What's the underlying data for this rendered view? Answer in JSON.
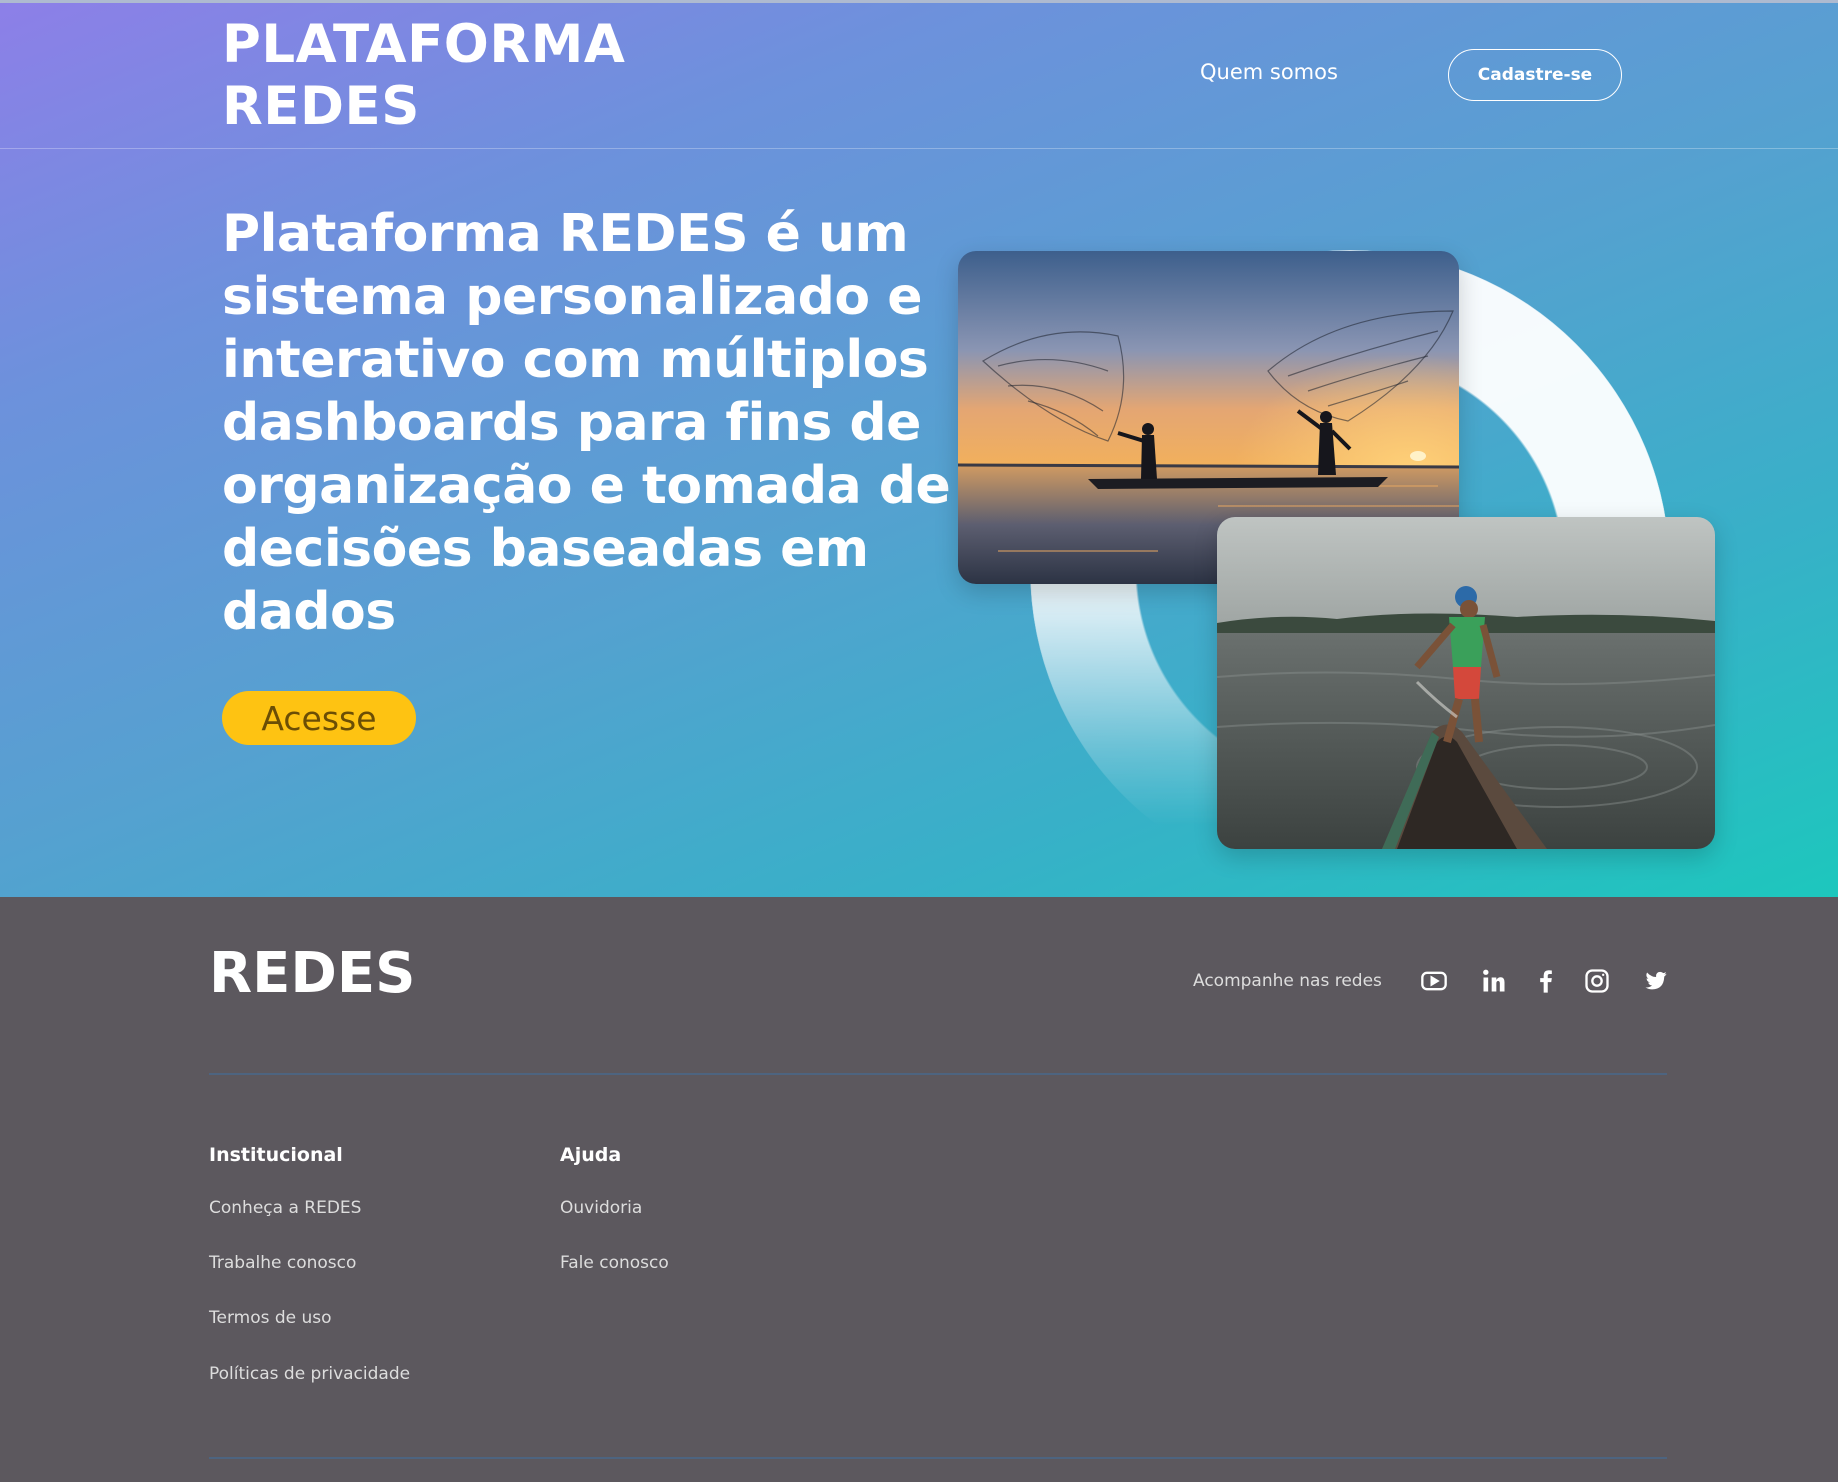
{
  "header": {
    "logo_line1": "PLATAFORMA",
    "logo_line2": "REDES",
    "nav_about": "Quem somos",
    "signup_label": "Cadastre-se"
  },
  "hero": {
    "headline": "Plataforma REDES é um sistema personalizado e interativo com múltiplos dashboards para fins de organização e tomada de decisões baseadas em dados",
    "cta_label": "Acesse",
    "accent_color": "#fec312"
  },
  "footer": {
    "logo": "REDES",
    "follow_label": "Acompanhe nas redes",
    "socials": [
      "youtube-icon",
      "linkedin-icon",
      "facebook-icon",
      "instagram-icon",
      "twitter-icon"
    ],
    "institucional": {
      "title": "Institucional",
      "links": [
        "Conheça a REDES",
        "Trabalhe conosco",
        "Termos de uso",
        "Políticas de privacidade"
      ]
    },
    "ajuda": {
      "title": "Ajuda",
      "links": [
        "Ouvidoria",
        "Fale conosco"
      ]
    }
  }
}
